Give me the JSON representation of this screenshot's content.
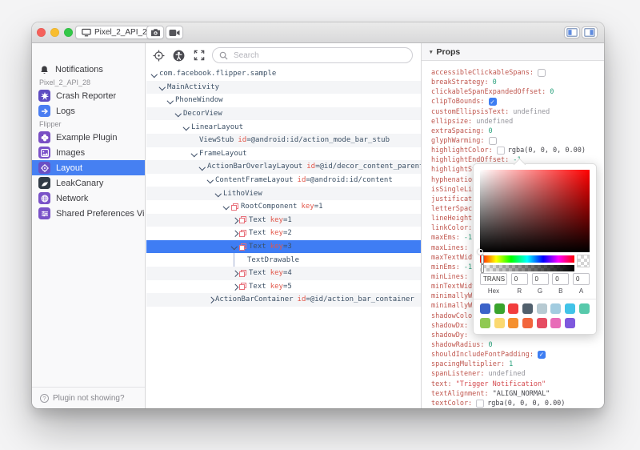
{
  "titlebar": {
    "device_tab": "Pixel_2_API_28",
    "traffic_colors": {
      "close": "#f5615b",
      "minimize": "#f8bd2f",
      "zoom": "#33c748"
    }
  },
  "accent": {
    "sidebar_selection": "#4680f2",
    "tree_selection": "#3f7df4"
  },
  "sidebar": {
    "notifications_label": "Notifications",
    "sections": [
      {
        "label": "Pixel_2_API_28",
        "items": [
          {
            "label": "Crash Reporter",
            "icon": "crash-reporter-icon",
            "bg": "#5f4cc2"
          },
          {
            "label": "Logs",
            "icon": "logs-icon",
            "bg": "#4a7df2"
          }
        ]
      },
      {
        "label": "Flipper",
        "items": [
          {
            "label": "Example Plugin",
            "icon": "example-plugin-icon",
            "bg": "#7a4fc4"
          },
          {
            "label": "Images",
            "icon": "images-icon",
            "bg": "#7b52c9"
          },
          {
            "label": "Layout",
            "icon": "layout-icon",
            "bg": "#6a4fc4",
            "selected": true
          },
          {
            "label": "LeakCanary",
            "icon": "leakcanary-icon",
            "bg": "#323c46"
          },
          {
            "label": "Network",
            "icon": "network-icon",
            "bg": "#7a52c8"
          },
          {
            "label": "Shared Preferences Viewer",
            "icon": "shared-preferences-icon",
            "bg": "#7a52c8"
          }
        ]
      }
    ],
    "footer_label": "Plugin not showing?"
  },
  "toolbar": {
    "search_placeholder": "Search"
  },
  "tree": {
    "rows": [
      {
        "indent": 0,
        "chevron": "down",
        "name": "com.facebook.flipper.sample"
      },
      {
        "indent": 1,
        "chevron": "down",
        "name": "MainActivity"
      },
      {
        "indent": 2,
        "chevron": "down",
        "name": "PhoneWindow"
      },
      {
        "indent": 3,
        "chevron": "down",
        "name": "DecorView"
      },
      {
        "indent": 4,
        "chevron": "down",
        "name": "LinearLayout"
      },
      {
        "indent": 5,
        "chevron": "none",
        "name": "ViewStub",
        "attr_key": "id",
        "attr_value": "=@android:id/action_mode_bar_stub"
      },
      {
        "indent": 5,
        "chevron": "down",
        "name": "FrameLayout"
      },
      {
        "indent": 6,
        "chevron": "down",
        "name": "ActionBarOverlayLayout",
        "attr_key": "id",
        "attr_value": "=@id/decor_content_parent"
      },
      {
        "indent": 7,
        "chevron": "down",
        "name": "ContentFrameLayout",
        "attr_key": "id",
        "attr_value": "=@android:id/content"
      },
      {
        "indent": 8,
        "chevron": "down",
        "name": "LithoView"
      },
      {
        "indent": 9,
        "chevron": "down",
        "litho": true,
        "name": "RootComponent",
        "attr_key": "key",
        "attr_value": "=1"
      },
      {
        "indent": 10,
        "chevron": "right",
        "litho": true,
        "name": "Text",
        "attr_key": "key",
        "attr_value": "=1"
      },
      {
        "indent": 10,
        "chevron": "right",
        "litho": true,
        "name": "Text",
        "attr_key": "key",
        "attr_value": "=2"
      },
      {
        "indent": 10,
        "chevron": "down",
        "litho": true,
        "name": "Text",
        "attr_key": "key",
        "attr_value": "=3",
        "selected": true
      },
      {
        "indent": 11,
        "chevron": "guide",
        "name": "TextDrawable"
      },
      {
        "indent": 10,
        "chevron": "right",
        "litho": true,
        "name": "Text",
        "attr_key": "key",
        "attr_value": "=4"
      },
      {
        "indent": 10,
        "chevron": "right",
        "litho": true,
        "name": "Text",
        "attr_key": "key",
        "attr_value": "=5"
      },
      {
        "indent": 7,
        "chevron": "right",
        "name": "ActionBarContainer",
        "attr_key": "id",
        "attr_value": "=@id/action_bar_container"
      }
    ]
  },
  "props": {
    "header": "Props",
    "rows": [
      {
        "name": "accessibleClickableSpans",
        "type": "checkbox",
        "value": false
      },
      {
        "name": "breakStrategy",
        "type": "number",
        "value": "0"
      },
      {
        "name": "clickableSpanExpandedOffset",
        "type": "number",
        "value": "0"
      },
      {
        "name": "clipToBounds",
        "type": "checkbox",
        "value": true
      },
      {
        "name": "customEllipsisText",
        "type": "undefined",
        "value": "undefined"
      },
      {
        "name": "ellipsize",
        "type": "undefined",
        "value": "undefined"
      },
      {
        "name": "extraSpacing",
        "type": "number",
        "value": "0"
      },
      {
        "name": "glyphWarming",
        "type": "checkbox",
        "value": false
      },
      {
        "name": "highlightColor",
        "type": "color",
        "value": "rgba(0, 0, 0, 0.00)"
      },
      {
        "name": "highlightEndOffset",
        "type": "number",
        "value": "-1"
      },
      {
        "name": "highlightStartOffset",
        "type": "none",
        "value": ""
      },
      {
        "name": "hyphenationFrequency",
        "type": "none",
        "value": ""
      },
      {
        "name": "isSingleLine",
        "type": "none",
        "value": ""
      },
      {
        "name": "justificationMode",
        "type": "none",
        "value": ""
      },
      {
        "name": "letterSpacing",
        "type": "none",
        "value": ""
      },
      {
        "name": "lineHeight",
        "type": "none",
        "value": ""
      },
      {
        "name": "linkColor",
        "type": "none",
        "value": ""
      },
      {
        "name": "maxEms",
        "type": "number",
        "value": "-1"
      },
      {
        "name": "maxLines",
        "type": "none",
        "value": ""
      },
      {
        "name": "maxTextWidth",
        "type": "none",
        "value": ""
      },
      {
        "name": "minEms",
        "type": "number",
        "value": "-1"
      },
      {
        "name": "minLines",
        "type": "none",
        "value": ""
      },
      {
        "name": "minTextWidth",
        "type": "none",
        "value": ""
      },
      {
        "name": "minimallyWide",
        "type": "none",
        "value": ""
      },
      {
        "name": "minimallyWideThreshold",
        "type": "none",
        "value": ""
      },
      {
        "name": "shadowColor",
        "type": "none",
        "value": ""
      },
      {
        "name": "shadowDx",
        "type": "none",
        "value": ""
      },
      {
        "name": "shadowDy",
        "type": "none",
        "value": ""
      },
      {
        "name": "shadowRadius",
        "type": "number",
        "value": "0"
      },
      {
        "name": "shouldIncludeFontPadding",
        "type": "checkbox",
        "value": true
      },
      {
        "name": "spacingMultiplier",
        "type": "number",
        "value": "1"
      },
      {
        "name": "spanListener",
        "type": "undefined",
        "value": "undefined"
      },
      {
        "name": "text",
        "type": "string",
        "value": "\"Trigger Notification\""
      },
      {
        "name": "textAlignment",
        "type": "enum",
        "value": "\"ALIGN_NORMAL\""
      },
      {
        "name": "textColor",
        "type": "color",
        "value": "rgba(0, 0, 0, 0.00)"
      }
    ]
  },
  "color_picker": {
    "fields": [
      {
        "label": "Hex",
        "value": "TRANS"
      },
      {
        "label": "R",
        "value": "0"
      },
      {
        "label": "G",
        "value": "0"
      },
      {
        "label": "B",
        "value": "0"
      },
      {
        "label": "A",
        "value": "0"
      }
    ],
    "swatches": [
      [
        "#3b63c9",
        "#3aa42c",
        "#f23d3d",
        "#51606d",
        "#b7cad2",
        "#a2cce0",
        "#41c3e8",
        "#57c9ab"
      ],
      [
        "#90c953",
        "#fbd970",
        "#f5902f",
        "#f2653c",
        "#e64c62",
        "#e86cb8",
        "#7e58dd"
      ]
    ]
  }
}
